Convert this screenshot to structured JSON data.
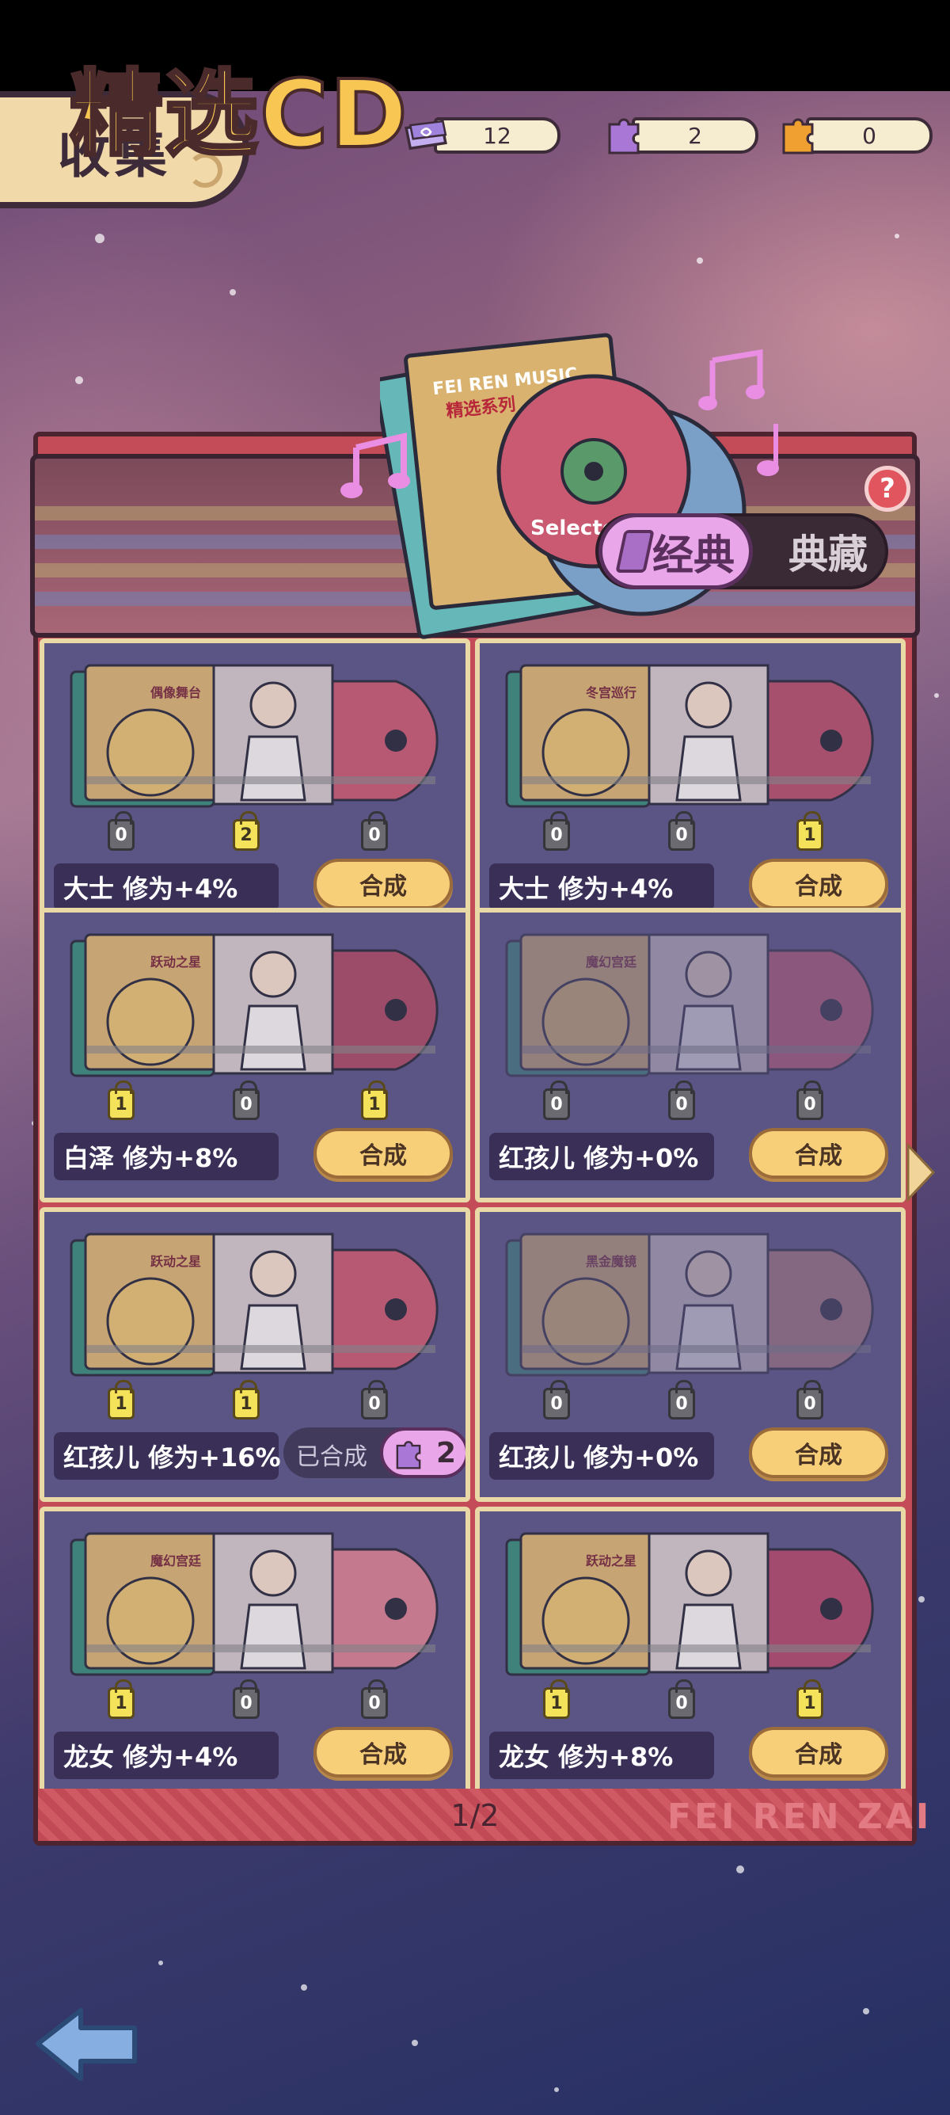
{
  "header": {
    "title": "收集",
    "resources": [
      {
        "icon": "ticket-icon",
        "value": "12",
        "color": "#a98ae0"
      },
      {
        "icon": "purple-puzzle-icon",
        "value": "2",
        "color": "#a978d6"
      },
      {
        "icon": "orange-puzzle-icon",
        "value": "0",
        "color": "#f0a030"
      }
    ]
  },
  "banner": {
    "title": "精选CD",
    "toggle": {
      "active": "经典",
      "inactive": "典藏"
    },
    "help": "?",
    "album_text": [
      "FEI REN MUSIC",
      "精选系列",
      "Selected"
    ]
  },
  "cards": [
    {
      "album": "偶像舞台",
      "counts": [
        "0",
        "2",
        "0"
      ],
      "count_styles": [
        "grey",
        "yellow",
        "grey"
      ],
      "bonus": "大士  修为+4%",
      "action": "合成"
    },
    {
      "album": "冬宫巡行",
      "counts": [
        "0",
        "0",
        "1"
      ],
      "count_styles": [
        "grey",
        "grey",
        "yellow"
      ],
      "bonus": "大士  修为+4%",
      "action": "合成"
    },
    {
      "album": "跃动之星",
      "counts": [
        "1",
        "0",
        "1"
      ],
      "count_styles": [
        "yellow",
        "grey",
        "yellow"
      ],
      "bonus": "白泽  修为+8%",
      "action": "合成"
    },
    {
      "album": "魔幻宫廷",
      "counts": [
        "0",
        "0",
        "0"
      ],
      "count_styles": [
        "grey",
        "grey",
        "grey"
      ],
      "bonus": "红孩儿 修为+0%",
      "action": "合成"
    },
    {
      "album": "跃动之星",
      "counts": [
        "1",
        "1",
        "0"
      ],
      "count_styles": [
        "yellow",
        "yellow",
        "grey"
      ],
      "bonus": "红孩儿 修为+16%",
      "action": "已合成",
      "fragments": "2"
    },
    {
      "album": "黑金魔镜",
      "counts": [
        "0",
        "0",
        "0"
      ],
      "count_styles": [
        "grey",
        "grey",
        "grey"
      ],
      "bonus": "红孩儿 修为+0%",
      "action": "合成"
    },
    {
      "album": "魔幻宫廷",
      "counts": [
        "1",
        "0",
        "0"
      ],
      "count_styles": [
        "yellow",
        "grey",
        "grey"
      ],
      "bonus": "龙女  修为+4%",
      "action": "合成"
    },
    {
      "album": "跃动之星",
      "counts": [
        "1",
        "0",
        "1"
      ],
      "count_styles": [
        "yellow",
        "grey",
        "yellow"
      ],
      "bonus": "龙女  修为+8%",
      "action": "合成"
    }
  ],
  "pager": {
    "current": "1/2"
  },
  "watermark": "FEI REN ZAI",
  "colors": {
    "craft_button": "#f7cf79",
    "card_bg": "#5a5585",
    "panel_red": "#c44c58",
    "accent_pink": "#e9a6e8"
  }
}
